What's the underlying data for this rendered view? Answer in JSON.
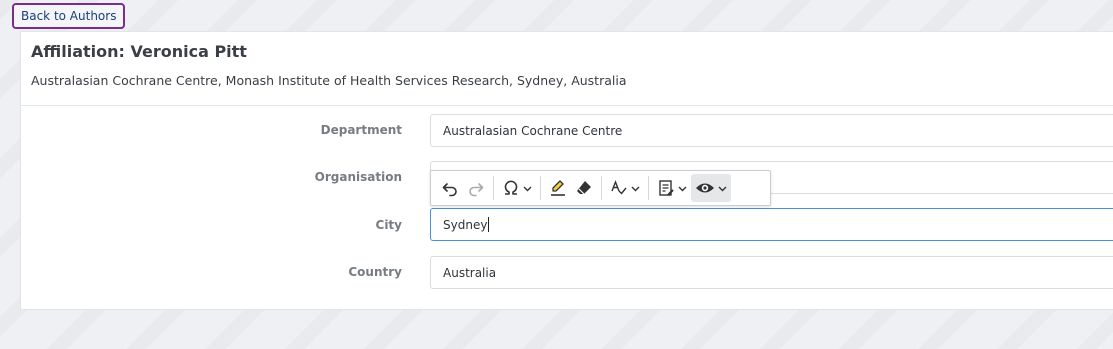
{
  "nav": {
    "back_label": "Back to Authors"
  },
  "header": {
    "title": "Affiliation: Veronica Pitt",
    "subtitle": "Australasian Cochrane Centre, Monash Institute of Health Services Research, Sydney, Australia"
  },
  "form": {
    "department": {
      "label": "Department",
      "value": "Australasian Cochrane Centre"
    },
    "organisation": {
      "label": "Organisation",
      "value": ""
    },
    "city": {
      "label": "City",
      "value": "Sydney"
    },
    "country": {
      "label": "Country",
      "value": "Australia"
    }
  },
  "toolbar": {
    "buttons": [
      "undo-icon",
      "redo-icon",
      "special-characters-icon",
      "highlight-icon",
      "eraser-icon",
      "spellcheck-icon",
      "notes-icon",
      "preview-eye-icon"
    ]
  },
  "colors": {
    "back_button_border": "#7b2d8e",
    "focus_border": "#4a90d9",
    "label_text": "#777c83"
  }
}
